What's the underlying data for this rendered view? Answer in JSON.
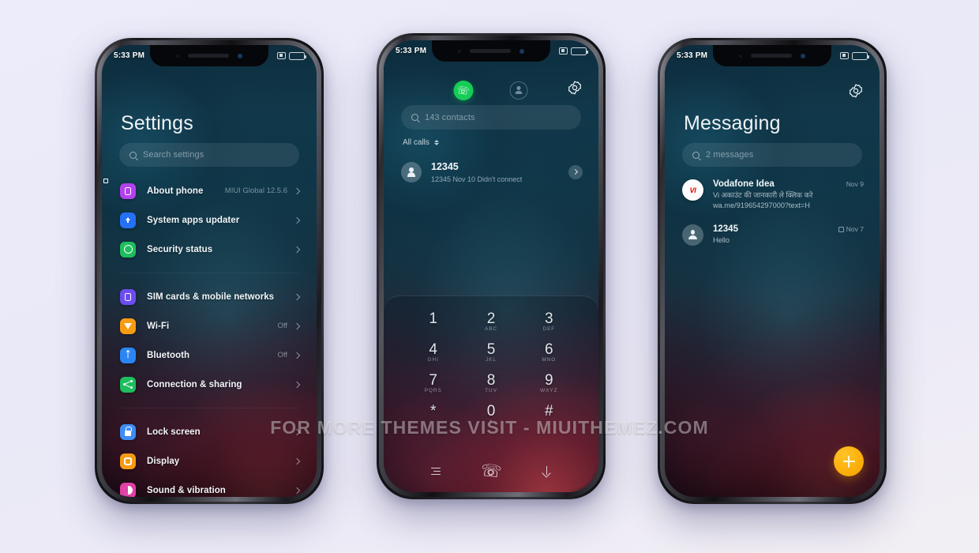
{
  "watermark": "FOR MORE THEMES VISIT - MIUITHEMEZ.COM",
  "colors": {
    "page_background": "#ececfa",
    "accent_green": "#15cd56",
    "accent_amber": "#fcb00c",
    "vi_red": "#e60000"
  },
  "statusbar": {
    "time": "5:33 PM"
  },
  "phone1": {
    "title": "Settings",
    "search_placeholder": "Search settings",
    "groups": [
      {
        "items": [
          {
            "icon": "about-phone-icon",
            "label": "About phone",
            "value": "MIUI Global 12.5.6",
            "color": "#b341f0"
          },
          {
            "icon": "system-updater-icon",
            "label": "System apps updater",
            "value": "",
            "color": "#2471f5"
          },
          {
            "icon": "security-status-icon",
            "label": "Security status",
            "value": "",
            "color": "#1ebd5e"
          }
        ]
      },
      {
        "items": [
          {
            "icon": "sim-card-icon",
            "label": "SIM cards & mobile networks",
            "value": "",
            "color": "#6b4df2"
          },
          {
            "icon": "wifi-icon",
            "label": "Wi-Fi",
            "value": "Off",
            "color": "#f79b12"
          },
          {
            "icon": "bluetooth-icon",
            "label": "Bluetooth",
            "value": "Off",
            "color": "#2a85f5"
          },
          {
            "icon": "connection-sharing-icon",
            "label": "Connection & sharing",
            "value": "",
            "color": "#1ebd5e"
          }
        ]
      },
      {
        "items": [
          {
            "icon": "lock-screen-icon",
            "label": "Lock screen",
            "value": "",
            "color": "#3e8df5"
          },
          {
            "icon": "display-icon",
            "label": "Display",
            "value": "",
            "color": "#f79b12"
          },
          {
            "icon": "sound-vibration-icon",
            "label": "Sound & vibration",
            "value": "",
            "color": "#e040a5"
          }
        ]
      }
    ]
  },
  "phone2": {
    "search_placeholder": "143 contacts",
    "filter_label": "All calls",
    "call": {
      "name": "12345",
      "subtitle": "12345  Nov 10  Didn't connect"
    },
    "keypad": [
      {
        "digit": "1",
        "letters": ""
      },
      {
        "digit": "2",
        "letters": "ABC"
      },
      {
        "digit": "3",
        "letters": "DEF"
      },
      {
        "digit": "4",
        "letters": "GHI"
      },
      {
        "digit": "5",
        "letters": "JKL"
      },
      {
        "digit": "6",
        "letters": "MNO"
      },
      {
        "digit": "7",
        "letters": "PQRS"
      },
      {
        "digit": "8",
        "letters": "TUV"
      },
      {
        "digit": "9",
        "letters": "WXYZ"
      },
      {
        "digit": "*",
        "letters": ""
      },
      {
        "digit": "0",
        "letters": "+"
      },
      {
        "digit": "#",
        "letters": ""
      }
    ]
  },
  "phone3": {
    "title": "Messaging",
    "search_placeholder": "2 messages",
    "messages": [
      {
        "avatar": "VI",
        "name": "Vodafone Idea",
        "preview": "Vi अकाउंट की जानकारी ले क्लिक करे wa.me/919654297000?text=H",
        "date": "Nov 9",
        "has_sim_icon": false
      },
      {
        "avatar": "",
        "name": "12345",
        "preview": "Hello",
        "date": "Nov 7",
        "has_sim_icon": true
      }
    ],
    "fab_label": "+"
  }
}
